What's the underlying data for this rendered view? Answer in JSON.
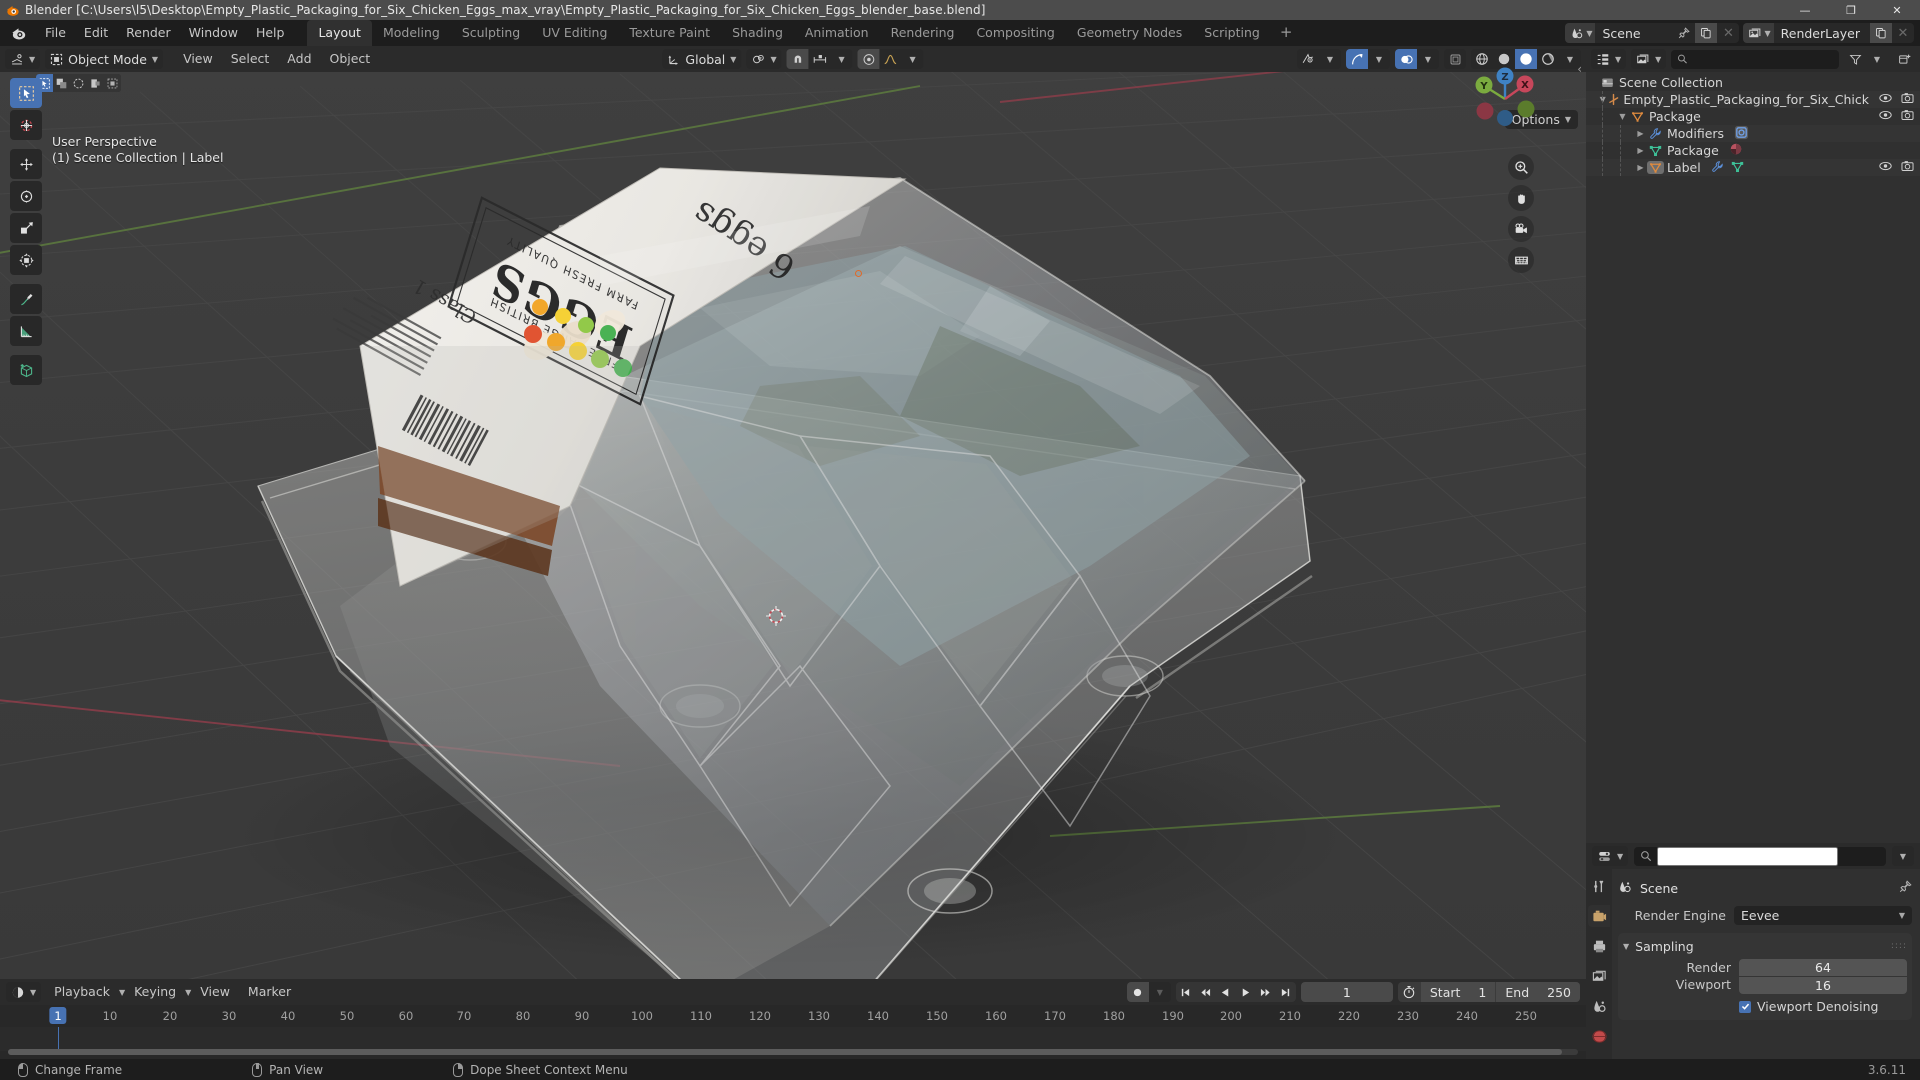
{
  "window": {
    "title": "Blender [C:\\Users\\l5\\Desktop\\Empty_Plastic_Packaging_for_Six_Chicken_Eggs_max_vray\\Empty_Plastic_Packaging_for_Six_Chicken_Eggs_blender_base.blend]",
    "minimize": "—",
    "maximize": "❐",
    "close": "✕"
  },
  "topbar": {
    "menus": [
      "File",
      "Edit",
      "Render",
      "Window",
      "Help"
    ],
    "workspaces": [
      "Layout",
      "Modeling",
      "Sculpting",
      "UV Editing",
      "Texture Paint",
      "Shading",
      "Animation",
      "Rendering",
      "Compositing",
      "Geometry Nodes",
      "Scripting"
    ],
    "active_workspace": "Layout",
    "add_workspace": "+",
    "scene": {
      "icon": "scene-icon",
      "name": "Scene",
      "pin": "pin-icon",
      "copy": "new-copy-icon",
      "unlink": "✕"
    },
    "view_layer": {
      "icon": "renderlayers-icon",
      "name": "RenderLayer",
      "copy": "new-copy-icon",
      "unlink": "✕"
    }
  },
  "viewport": {
    "mode": "Object Mode",
    "menus": [
      "View",
      "Select",
      "Add",
      "Object"
    ],
    "transform_orientation": "Global",
    "options_label": "Options",
    "overlay_text_line1": "User Perspective",
    "overlay_text_line2": "(1) Scene Collection | Label",
    "gizmo_axes": [
      "X",
      "Y",
      "Z"
    ],
    "select_modes": [
      "tweak",
      "box-select",
      "circle-select",
      "lasso-select",
      "select-all"
    ],
    "shading_modes": [
      "wireframe",
      "solid",
      "material-preview",
      "rendered"
    ],
    "active_shading": "material-preview",
    "tools": [
      "tweak-tool",
      "cursor-tool",
      "move-tool",
      "rotate-tool",
      "scale-tool",
      "transform-tool",
      "annotate-tool",
      "measure-tool",
      "add-cube-tool"
    ],
    "active_tool": "tweak-tool",
    "nav_buttons": [
      "zoom-icon",
      "hand-icon",
      "camera-icon",
      "ortho-persp-icon"
    ]
  },
  "outliner": {
    "display_mode": "View Layer",
    "search_placeholder": "",
    "filter_label": "filter-icon",
    "rows": [
      {
        "label": "Scene Collection",
        "icon": "collection-icon",
        "indent": 0,
        "expander": "",
        "restrict": []
      },
      {
        "label": "Empty_Plastic_Packaging_for_Six_Chick",
        "icon": "empty-axis-icon",
        "indent": 1,
        "expander": "▼",
        "restrict": [
          "eye-icon",
          "camera-icon"
        ]
      },
      {
        "label": "Package",
        "icon": "mesh-data-icon",
        "indent": 2,
        "expander": "▼",
        "restrict": [
          "eye-icon",
          "camera-icon"
        ]
      },
      {
        "label": "Modifiers",
        "icon": "wrench-icon",
        "indent": 3,
        "expander": "▶",
        "badge": "modifier-icon",
        "restrict": []
      },
      {
        "label": "Package",
        "icon": "mesh-tri-icon",
        "indent": 3,
        "expander": "▶",
        "badge": "material-icon",
        "restrict": []
      },
      {
        "label": "Label",
        "icon": "object-data-icon",
        "indent": 3,
        "expander": "▶",
        "badge2": [
          "wrench-icon",
          "mesh-tri-icon"
        ],
        "restrict": [
          "eye-icon",
          "camera-icon"
        ]
      }
    ]
  },
  "properties": {
    "search_placeholder": "",
    "context_name": "Scene",
    "context_icon": "scene-icon",
    "pin_icon": "pin-icon",
    "render_engine_label": "Render Engine",
    "render_engine_value": "Eevee",
    "sampling_panel": "Sampling",
    "rows": [
      {
        "label": "Render",
        "value": "64"
      },
      {
        "label": "Viewport",
        "value": "16"
      }
    ],
    "viewport_denoising_label": "Viewport Denoising",
    "viewport_denoising_checked": true,
    "tabs": [
      "tool-tab",
      "render-tab",
      "output-tab",
      "view-layer-tab",
      "scene-tab",
      "world-tab"
    ],
    "active_tab": "render-tab"
  },
  "timeline": {
    "menus": [
      "Playback",
      "Keying",
      "View",
      "Marker"
    ],
    "current_frame": "1",
    "start_label": "Start",
    "start_value": "1",
    "end_label": "End",
    "end_value": "250",
    "ticks": [
      "1",
      "10",
      "20",
      "30",
      "40",
      "50",
      "60",
      "70",
      "80",
      "90",
      "100",
      "110",
      "120",
      "130",
      "140",
      "150",
      "160",
      "170",
      "180",
      "190",
      "200",
      "210",
      "220",
      "230",
      "240",
      "250"
    ],
    "transport": [
      "jump-start-icon",
      "prev-keyframe-icon",
      "play-reverse-icon",
      "play-icon",
      "next-keyframe-icon",
      "jump-end-icon"
    ]
  },
  "statusbar": {
    "hints": [
      {
        "mouse": "left",
        "text": "Change Frame"
      },
      {
        "mouse": "middle",
        "text": "Pan View"
      },
      {
        "mouse": "right",
        "text": "Dope Sheet Context Menu"
      }
    ],
    "version": "3.6.11"
  },
  "colors": {
    "accent": "#4772b3",
    "header": "#2b2b2b",
    "panel": "#303030",
    "viewport": "#3c3c3c",
    "titlebar": "#4c4c4c",
    "axis_x": "#c7475b",
    "axis_y": "#7bab3f",
    "axis_z": "#3f82c4",
    "orange": "#e06a28"
  }
}
